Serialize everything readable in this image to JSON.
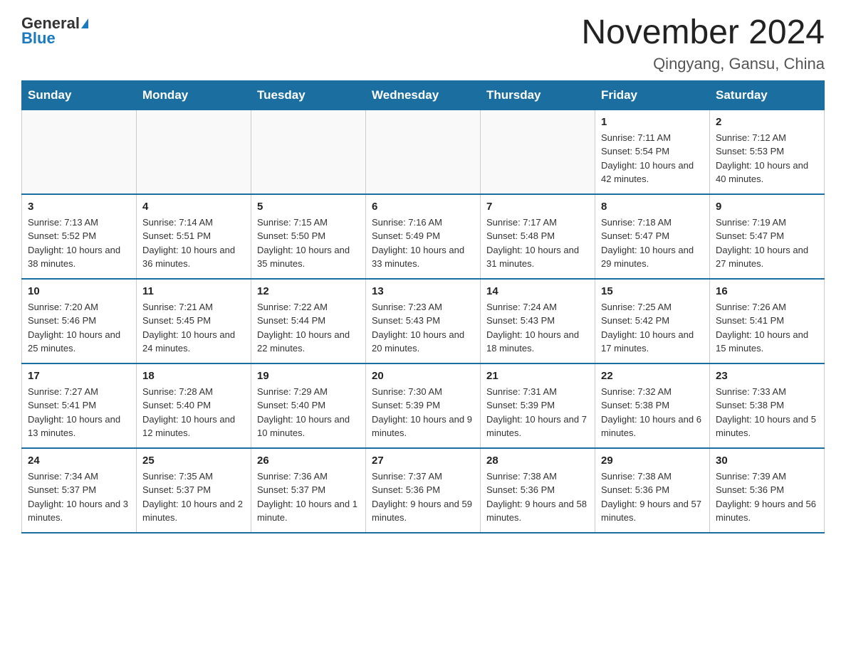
{
  "logo": {
    "general": "General",
    "blue": "Blue"
  },
  "title": "November 2024",
  "subtitle": "Qingyang, Gansu, China",
  "days_of_week": [
    "Sunday",
    "Monday",
    "Tuesday",
    "Wednesday",
    "Thursday",
    "Friday",
    "Saturday"
  ],
  "weeks": [
    [
      {
        "day": "",
        "info": ""
      },
      {
        "day": "",
        "info": ""
      },
      {
        "day": "",
        "info": ""
      },
      {
        "day": "",
        "info": ""
      },
      {
        "day": "",
        "info": ""
      },
      {
        "day": "1",
        "info": "Sunrise: 7:11 AM\nSunset: 5:54 PM\nDaylight: 10 hours and 42 minutes."
      },
      {
        "day": "2",
        "info": "Sunrise: 7:12 AM\nSunset: 5:53 PM\nDaylight: 10 hours and 40 minutes."
      }
    ],
    [
      {
        "day": "3",
        "info": "Sunrise: 7:13 AM\nSunset: 5:52 PM\nDaylight: 10 hours and 38 minutes."
      },
      {
        "day": "4",
        "info": "Sunrise: 7:14 AM\nSunset: 5:51 PM\nDaylight: 10 hours and 36 minutes."
      },
      {
        "day": "5",
        "info": "Sunrise: 7:15 AM\nSunset: 5:50 PM\nDaylight: 10 hours and 35 minutes."
      },
      {
        "day": "6",
        "info": "Sunrise: 7:16 AM\nSunset: 5:49 PM\nDaylight: 10 hours and 33 minutes."
      },
      {
        "day": "7",
        "info": "Sunrise: 7:17 AM\nSunset: 5:48 PM\nDaylight: 10 hours and 31 minutes."
      },
      {
        "day": "8",
        "info": "Sunrise: 7:18 AM\nSunset: 5:47 PM\nDaylight: 10 hours and 29 minutes."
      },
      {
        "day": "9",
        "info": "Sunrise: 7:19 AM\nSunset: 5:47 PM\nDaylight: 10 hours and 27 minutes."
      }
    ],
    [
      {
        "day": "10",
        "info": "Sunrise: 7:20 AM\nSunset: 5:46 PM\nDaylight: 10 hours and 25 minutes."
      },
      {
        "day": "11",
        "info": "Sunrise: 7:21 AM\nSunset: 5:45 PM\nDaylight: 10 hours and 24 minutes."
      },
      {
        "day": "12",
        "info": "Sunrise: 7:22 AM\nSunset: 5:44 PM\nDaylight: 10 hours and 22 minutes."
      },
      {
        "day": "13",
        "info": "Sunrise: 7:23 AM\nSunset: 5:43 PM\nDaylight: 10 hours and 20 minutes."
      },
      {
        "day": "14",
        "info": "Sunrise: 7:24 AM\nSunset: 5:43 PM\nDaylight: 10 hours and 18 minutes."
      },
      {
        "day": "15",
        "info": "Sunrise: 7:25 AM\nSunset: 5:42 PM\nDaylight: 10 hours and 17 minutes."
      },
      {
        "day": "16",
        "info": "Sunrise: 7:26 AM\nSunset: 5:41 PM\nDaylight: 10 hours and 15 minutes."
      }
    ],
    [
      {
        "day": "17",
        "info": "Sunrise: 7:27 AM\nSunset: 5:41 PM\nDaylight: 10 hours and 13 minutes."
      },
      {
        "day": "18",
        "info": "Sunrise: 7:28 AM\nSunset: 5:40 PM\nDaylight: 10 hours and 12 minutes."
      },
      {
        "day": "19",
        "info": "Sunrise: 7:29 AM\nSunset: 5:40 PM\nDaylight: 10 hours and 10 minutes."
      },
      {
        "day": "20",
        "info": "Sunrise: 7:30 AM\nSunset: 5:39 PM\nDaylight: 10 hours and 9 minutes."
      },
      {
        "day": "21",
        "info": "Sunrise: 7:31 AM\nSunset: 5:39 PM\nDaylight: 10 hours and 7 minutes."
      },
      {
        "day": "22",
        "info": "Sunrise: 7:32 AM\nSunset: 5:38 PM\nDaylight: 10 hours and 6 minutes."
      },
      {
        "day": "23",
        "info": "Sunrise: 7:33 AM\nSunset: 5:38 PM\nDaylight: 10 hours and 5 minutes."
      }
    ],
    [
      {
        "day": "24",
        "info": "Sunrise: 7:34 AM\nSunset: 5:37 PM\nDaylight: 10 hours and 3 minutes."
      },
      {
        "day": "25",
        "info": "Sunrise: 7:35 AM\nSunset: 5:37 PM\nDaylight: 10 hours and 2 minutes."
      },
      {
        "day": "26",
        "info": "Sunrise: 7:36 AM\nSunset: 5:37 PM\nDaylight: 10 hours and 1 minute."
      },
      {
        "day": "27",
        "info": "Sunrise: 7:37 AM\nSunset: 5:36 PM\nDaylight: 9 hours and 59 minutes."
      },
      {
        "day": "28",
        "info": "Sunrise: 7:38 AM\nSunset: 5:36 PM\nDaylight: 9 hours and 58 minutes."
      },
      {
        "day": "29",
        "info": "Sunrise: 7:38 AM\nSunset: 5:36 PM\nDaylight: 9 hours and 57 minutes."
      },
      {
        "day": "30",
        "info": "Sunrise: 7:39 AM\nSunset: 5:36 PM\nDaylight: 9 hours and 56 minutes."
      }
    ]
  ]
}
